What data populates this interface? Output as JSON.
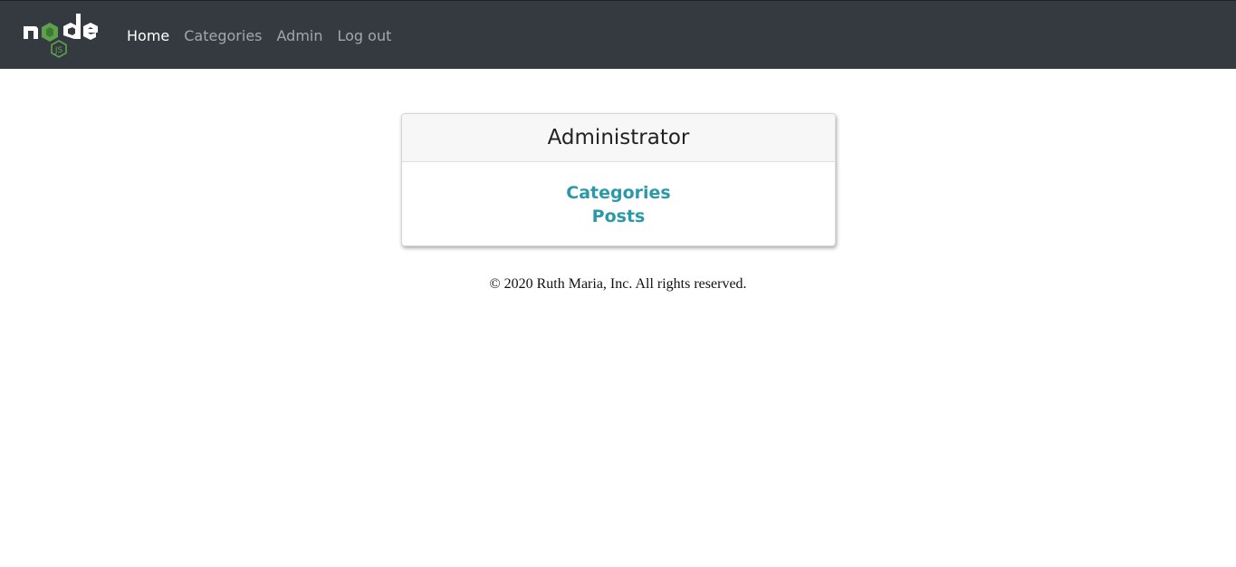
{
  "navbar": {
    "logo_icon": "nodejs-logo-icon",
    "logo_text": "node",
    "logo_badge": "JS",
    "links": [
      {
        "label": "Home",
        "active": true
      },
      {
        "label": "Categories",
        "active": false
      },
      {
        "label": "Admin",
        "active": false
      },
      {
        "label": "Log out",
        "active": false
      }
    ]
  },
  "admin_card": {
    "title": "Administrator",
    "links": [
      "Categories",
      "Posts"
    ]
  },
  "footer": {
    "text": "© 2020 Ruth Maria, Inc. All rights reserved."
  },
  "colors": {
    "navbar_bg": "#343a40",
    "link_accent": "#2b9aa8",
    "node_green": "#5fa04e"
  }
}
